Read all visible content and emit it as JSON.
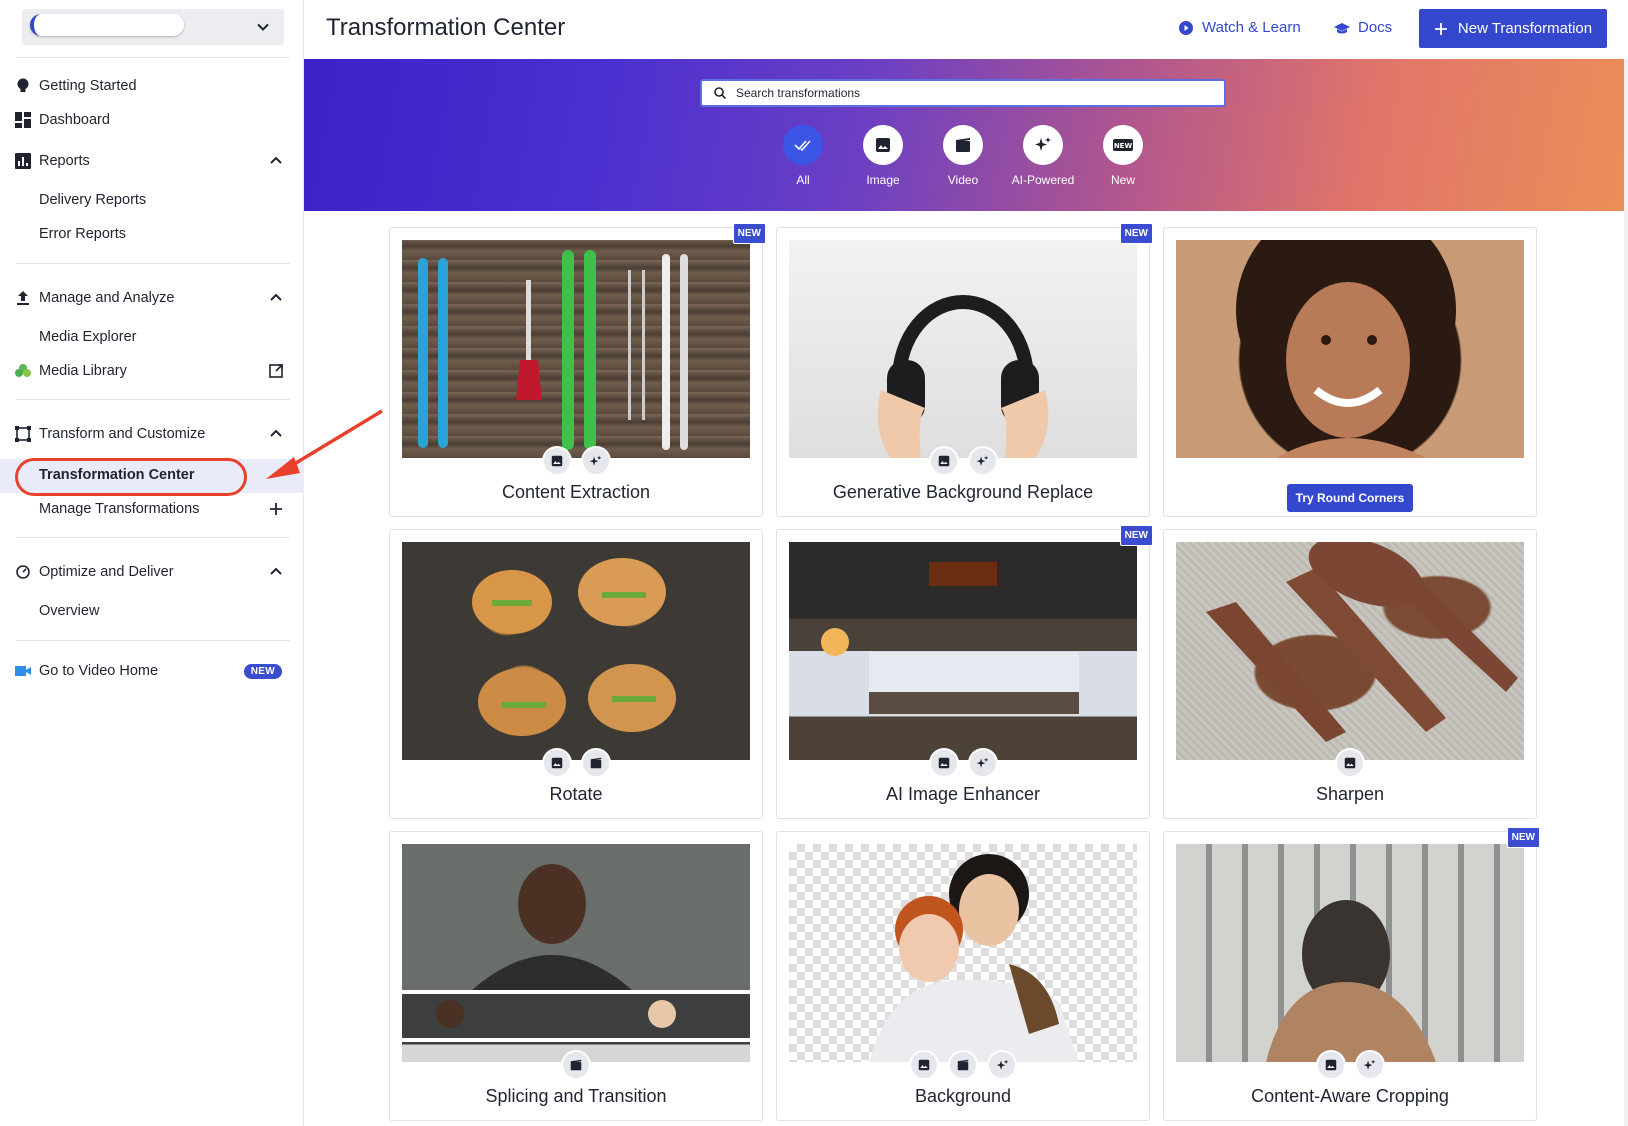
{
  "sidebar": {
    "items": [
      {
        "label": "Getting Started",
        "icon": "lightbulb-icon"
      },
      {
        "label": "Dashboard",
        "icon": "dashboard-icon"
      },
      {
        "label": "Reports",
        "icon": "reports-icon"
      },
      {
        "label": "Delivery Reports"
      },
      {
        "label": "Error Reports"
      },
      {
        "label": "Manage and Analyze",
        "icon": "upload-icon"
      },
      {
        "label": "Media Explorer"
      },
      {
        "label": "Media Library",
        "icon": "cloud-icon"
      },
      {
        "label": "Transform and Customize",
        "icon": "transform-icon"
      },
      {
        "label": "Transformation Center"
      },
      {
        "label": "Manage Transformations"
      },
      {
        "label": "Optimize and Deliver",
        "icon": "gauge-icon"
      },
      {
        "label": "Overview"
      },
      {
        "label": "Go to Video Home",
        "icon": "video-camera-icon"
      }
    ],
    "video_home_badge": "NEW"
  },
  "header": {
    "title": "Transformation Center",
    "watch_learn": "Watch & Learn",
    "docs": "Docs",
    "new_transformation": "New Transformation"
  },
  "search": {
    "placeholder": "Search transformations"
  },
  "filters": [
    "All",
    "Image",
    "Video",
    "AI-Powered",
    "New"
  ],
  "cards": [
    {
      "title": "Content Extraction",
      "new": "NEW"
    },
    {
      "title": "Generative Background Replace",
      "new": "NEW"
    },
    {
      "title": "",
      "try_label": "Try Round Corners"
    },
    {
      "title": "Rotate"
    },
    {
      "title": "AI Image Enhancer",
      "new": "NEW"
    },
    {
      "title": "Sharpen"
    },
    {
      "title": "Splicing and Transition"
    },
    {
      "title": "Background"
    },
    {
      "title": "Content-Aware Cropping",
      "new": "NEW"
    }
  ],
  "colors": {
    "accent": "#3348cc",
    "annotation": "#e8402a"
  }
}
